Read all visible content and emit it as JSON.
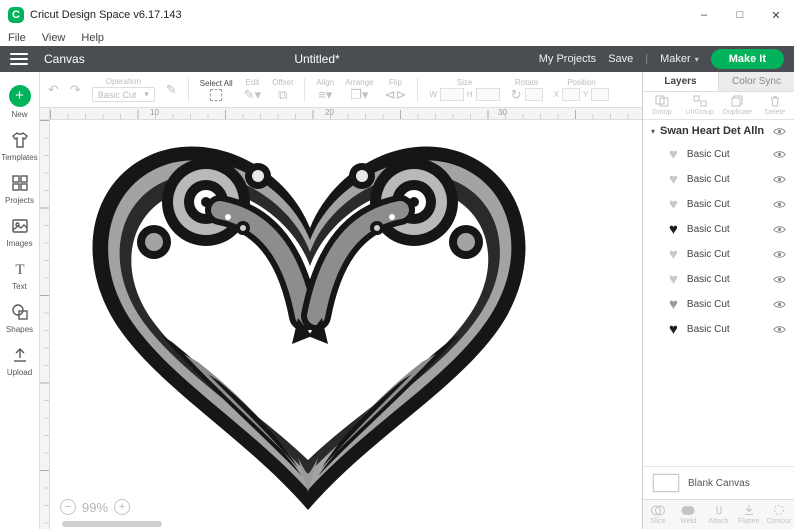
{
  "window": {
    "title": "Cricut Design Space  v6.17.143"
  },
  "menubar": {
    "items": [
      "File",
      "View",
      "Help"
    ]
  },
  "header": {
    "canvas_label": "Canvas",
    "document_title": "Untitled*",
    "my_projects": "My Projects",
    "save": "Save",
    "machine": "Maker",
    "make_it": "Make It"
  },
  "toolbar": {
    "operation_label": "Operation",
    "operation_value": "Basic Cut",
    "select_all": "Select All",
    "edit": "Edit",
    "offset": "Offset",
    "align": "Align",
    "arrange": "Arrange",
    "flip": "Flip",
    "size_label": "Size",
    "w_label": "W",
    "h_label": "H",
    "rotate_label": "Rotate",
    "position_label": "Position",
    "x_label": "X",
    "y_label": "Y"
  },
  "sidebar": {
    "items": [
      {
        "label": "New"
      },
      {
        "label": "Templates"
      },
      {
        "label": "Projects"
      },
      {
        "label": "Images"
      },
      {
        "label": "Text"
      },
      {
        "label": "Shapes"
      },
      {
        "label": "Upload"
      }
    ]
  },
  "canvas": {
    "ruler_marks": [
      "10",
      "20",
      "30"
    ],
    "zoom_level": "99%"
  },
  "layers_panel": {
    "tabs": [
      "Layers",
      "Color Sync"
    ],
    "actions": [
      "Group",
      "UnGroup",
      "Duplicate",
      "Delete"
    ],
    "group_name": "Swan Heart Det Alln",
    "layers": [
      {
        "label": "Basic Cut",
        "shade": "light"
      },
      {
        "label": "Basic Cut",
        "shade": "light"
      },
      {
        "label": "Basic Cut",
        "shade": "light"
      },
      {
        "label": "Basic Cut",
        "shade": "dark"
      },
      {
        "label": "Basic Cut",
        "shade": "light"
      },
      {
        "label": "Basic Cut",
        "shade": "light"
      },
      {
        "label": "Basic Cut",
        "shade": "medium"
      },
      {
        "label": "Basic Cut",
        "shade": "dark"
      }
    ],
    "blank_canvas_label": "Blank Canvas",
    "bottom_actions": [
      "Slice",
      "Weld",
      "Attach",
      "Flatten",
      "Contour"
    ]
  },
  "colors": {
    "accent_green": "#00b259",
    "header_bg": "#4a4d52"
  }
}
